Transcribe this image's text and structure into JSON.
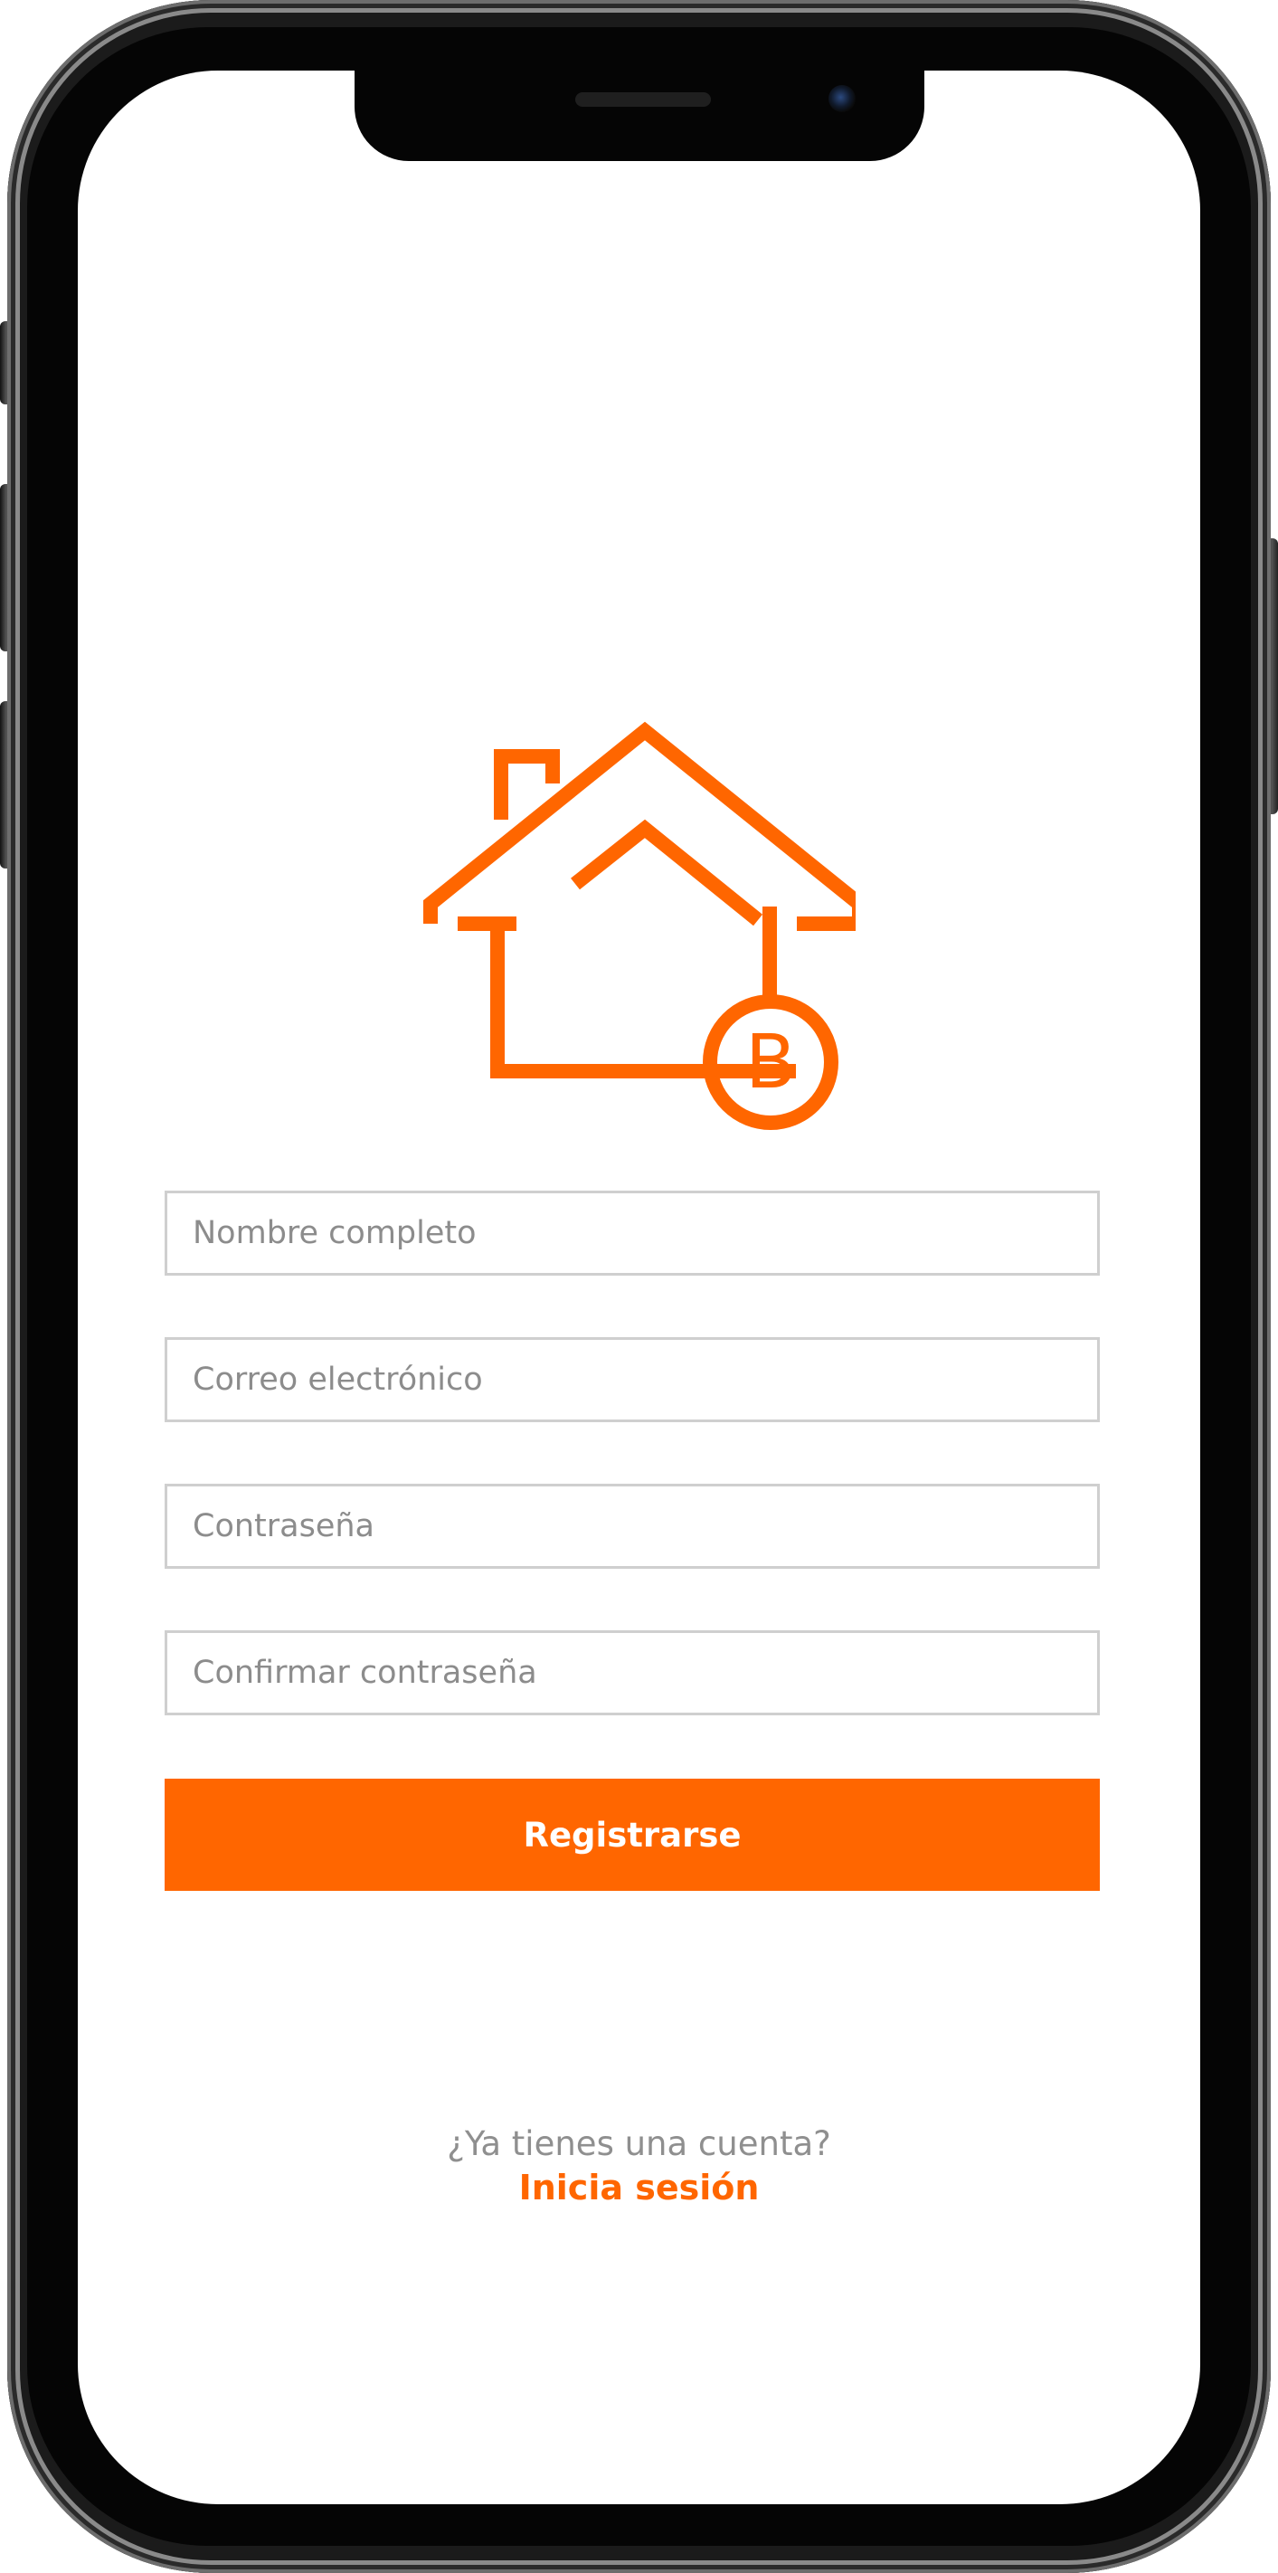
{
  "app": {
    "brand_color": "#ff6600",
    "logo": {
      "icon": "house-logo-icon",
      "letter": "B"
    }
  },
  "form": {
    "full_name": {
      "placeholder": "Nombre completo",
      "value": ""
    },
    "email": {
      "placeholder": "Correo electrónico",
      "value": ""
    },
    "password": {
      "placeholder": "Contraseña",
      "value": ""
    },
    "confirm_password": {
      "placeholder": "Confirmar contraseña",
      "value": ""
    },
    "submit_label": "Registrarse"
  },
  "footer": {
    "prompt": "¿Ya tienes una cuenta?",
    "login_label": "Inicia sesión"
  }
}
